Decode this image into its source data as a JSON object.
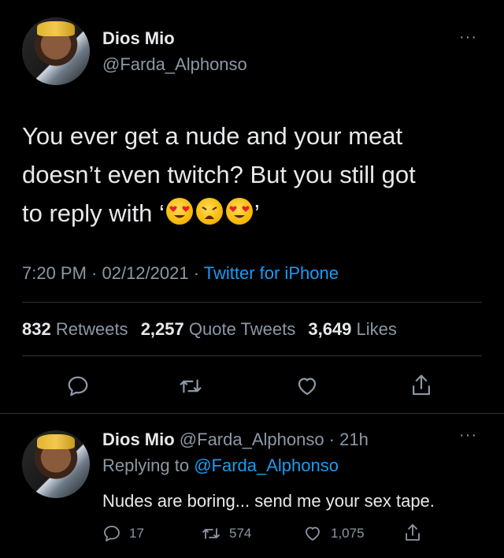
{
  "tweet": {
    "author_name": "Dios Mio",
    "author_handle": "@Farda_Alphonso",
    "more": "···",
    "text_line1": "You ever get a nude and your meat",
    "text_line2": "doesn’t even twitch? But you still got",
    "text_line3_prefix": "to reply with ‘",
    "text_line3_suffix": "’",
    "emojis": [
      "heart-eyes-emoji",
      "weary-face-emoji",
      "heart-eyes-emoji"
    ],
    "time": "7:20 PM · 02/12/2021 · ",
    "source": "Twitter for iPhone",
    "stats": {
      "retweets_count": "832",
      "retweets_label": "Retweets",
      "quotes_count": "2,257",
      "quotes_label": "Quote Tweets",
      "likes_count": "3,649",
      "likes_label": "Likes"
    },
    "actions": [
      "reply-icon",
      "retweet-icon",
      "like-icon",
      "share-icon"
    ]
  },
  "reply": {
    "author_name": "Dios Mio",
    "author_handle_time": "@Farda_Alphonso · 21h",
    "more": "···",
    "replying_prefix": "Replying to ",
    "replying_handle": "@Farda_Alphonso",
    "text": "Nudes are boring... send me your sex tape.",
    "reply_count": "17",
    "retweet_count": "574",
    "like_count": "1,075"
  },
  "colors": {
    "background": "#000000",
    "text": "#e7e9ea",
    "secondary": "#8b98a5",
    "accent": "#1d9bf0",
    "divider": "#2f3336"
  }
}
